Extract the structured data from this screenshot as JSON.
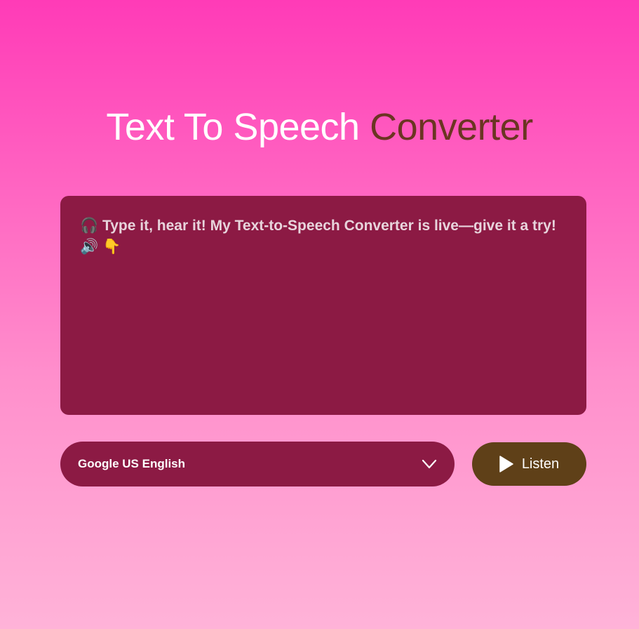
{
  "header": {
    "title_part1": "Text To Speech ",
    "title_part2": "Converter"
  },
  "editor": {
    "text": "🎧 Type it, hear it! My Text-to-Speech Converter is live—give it a try! 🔊 👇"
  },
  "voice_select": {
    "selected": "Google US English",
    "icon": "chevron-down-icon"
  },
  "listen_button": {
    "label": "Listen",
    "icon": "play-icon"
  },
  "colors": {
    "background_top": "#ff3bb7",
    "background_bottom": "#ffb3d8",
    "panel": "#8c1a44",
    "title_accent": "#6b3522",
    "button": "#5f4018"
  }
}
